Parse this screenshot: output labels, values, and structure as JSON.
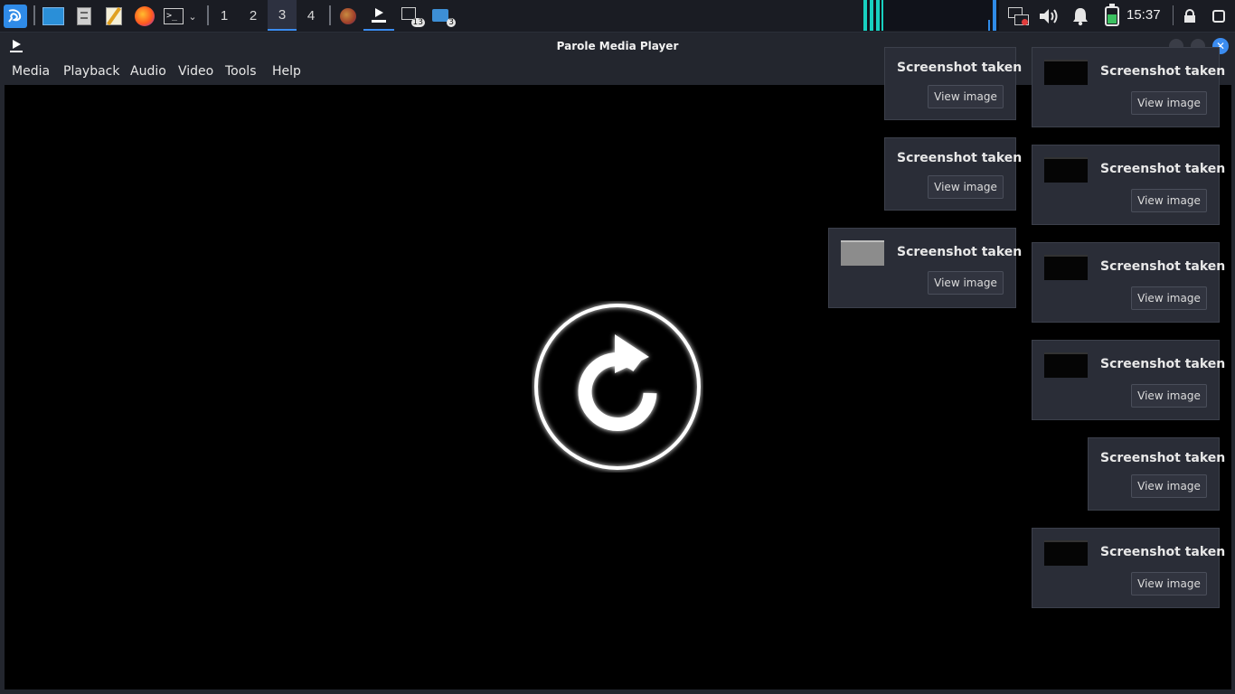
{
  "panel": {
    "workspaces": [
      "1",
      "2",
      "3",
      "4"
    ],
    "active_workspace": "3",
    "clock": "15:37",
    "task_badges": {
      "terminal": "13",
      "files": "3"
    },
    "accent_color": "#3b8cf0"
  },
  "window": {
    "title": "Parole Media Player",
    "menu": [
      "Media",
      "Playback",
      "Audio",
      "Video",
      "Tools",
      "Help"
    ],
    "center_icon": "replay-icon"
  },
  "notifications": {
    "title": "Screenshot taken",
    "button": "View image",
    "items": [
      {
        "title": "Screenshot taken",
        "button": "View image",
        "thumb": "none"
      },
      {
        "title": "Screenshot taken",
        "button": "View image",
        "thumb": "none"
      },
      {
        "title": "Screenshot taken",
        "button": "View image",
        "thumb": "grey"
      },
      {
        "title": "Screenshot taken",
        "button": "View image",
        "thumb": "dark"
      },
      {
        "title": "Screenshot taken",
        "button": "View image",
        "thumb": "dark"
      },
      {
        "title": "Screenshot taken",
        "button": "View image",
        "thumb": "dark"
      },
      {
        "title": "Screenshot taken",
        "button": "View image",
        "thumb": "dark"
      },
      {
        "title": "Screenshot taken",
        "button": "View image",
        "thumb": "none"
      },
      {
        "title": "Screenshot taken",
        "button": "View image",
        "thumb": "dark"
      }
    ]
  }
}
